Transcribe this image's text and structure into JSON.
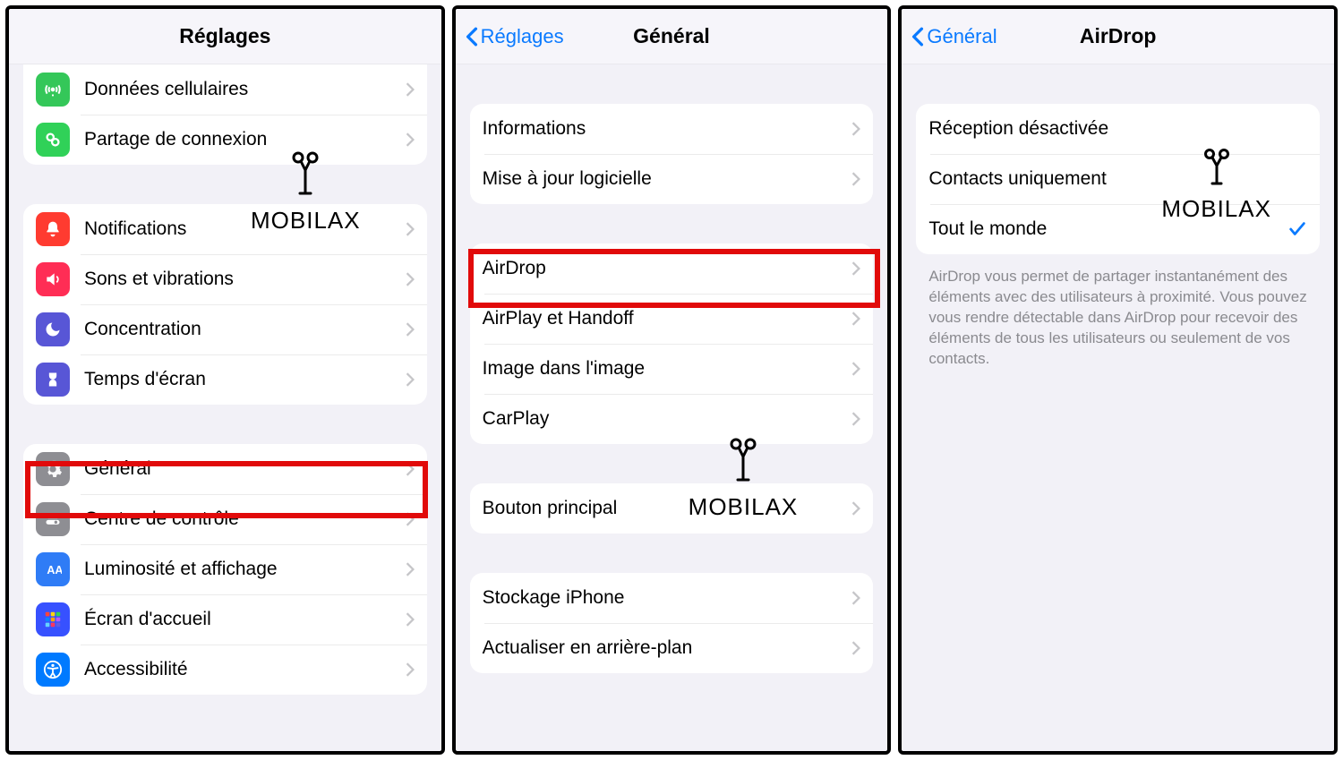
{
  "watermark": "MOBILAX",
  "screen1": {
    "title": "Réglages",
    "group1": {
      "cellular": "Données cellulaires",
      "hotspot": "Partage de connexion"
    },
    "group2": {
      "notifications": "Notifications",
      "sounds": "Sons et vibrations",
      "focus": "Concentration",
      "screentime": "Temps d'écran"
    },
    "group3": {
      "general": "Général",
      "controlcenter": "Centre de contrôle",
      "display": "Luminosité et affichage",
      "homescreen": "Écran d'accueil",
      "accessibility": "Accessibilité"
    }
  },
  "screen2": {
    "back": "Réglages",
    "title": "Général",
    "group1": {
      "about": "Informations",
      "update": "Mise à jour logicielle"
    },
    "group2": {
      "airdrop": "AirDrop",
      "airplay": "AirPlay et Handoff",
      "pip": "Image dans l'image",
      "carplay": "CarPlay"
    },
    "group3": {
      "homebutton": "Bouton principal"
    },
    "group4": {
      "storage": "Stockage iPhone",
      "background": "Actualiser en arrière-plan"
    }
  },
  "screen3": {
    "back": "Général",
    "title": "AirDrop",
    "options": {
      "off": "Réception désactivée",
      "contacts": "Contacts uniquement",
      "everyone": "Tout le monde"
    },
    "footer": "AirDrop vous permet de partager instantanément des éléments avec des utilisateurs à proximité. Vous pouvez vous rendre détectable dans AirDrop pour recevoir des éléments de tous les utilisateurs ou seulement de vos contacts."
  },
  "colors": {
    "green": "#34c759",
    "green2": "#30d158",
    "red": "#ff3b30",
    "pink": "#ff2d55",
    "purple": "#5856d6",
    "gray": "#8e8e93",
    "gray2": "#8e8e93",
    "blue": "#007aff",
    "blue2": "#2f7cf6",
    "multi": "#3a3a3c"
  }
}
